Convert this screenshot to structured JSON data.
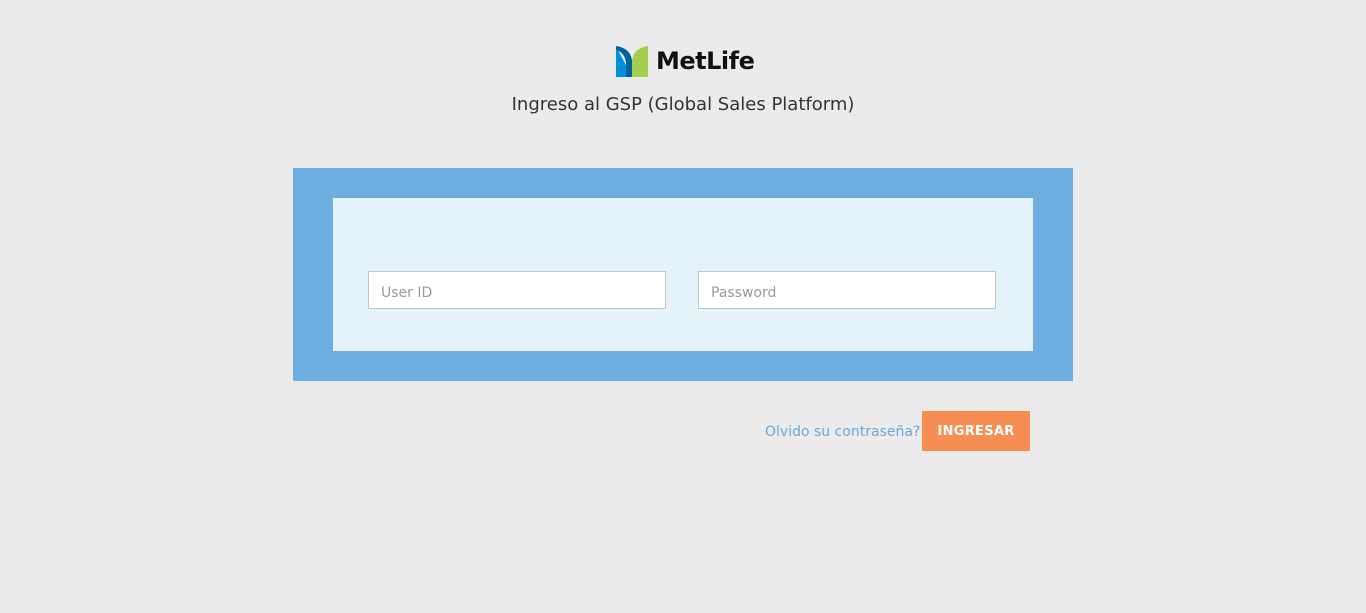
{
  "brand": {
    "logo_icon": "metlife-logo-icon",
    "logo_text": "MetLife",
    "colors": {
      "logo_blue": "#0090da",
      "logo_dark_blue": "#0061a0",
      "logo_green": "#a4ce4e"
    }
  },
  "header": {
    "subtitle": "Ingreso al GSP (Global Sales Platform)"
  },
  "login_form": {
    "user_id": {
      "value": "",
      "placeholder": "User ID"
    },
    "password": {
      "value": "",
      "placeholder": "Password"
    },
    "forgot_password_label": "Olvido su contraseña?",
    "submit_label": "INGRESAR"
  },
  "colors": {
    "page_background": "#ebebeb",
    "panel_outer": "#6daddf",
    "panel_inner": "#e4f3fa",
    "link": "#6aa6d8",
    "submit_button": "#f78f55"
  }
}
